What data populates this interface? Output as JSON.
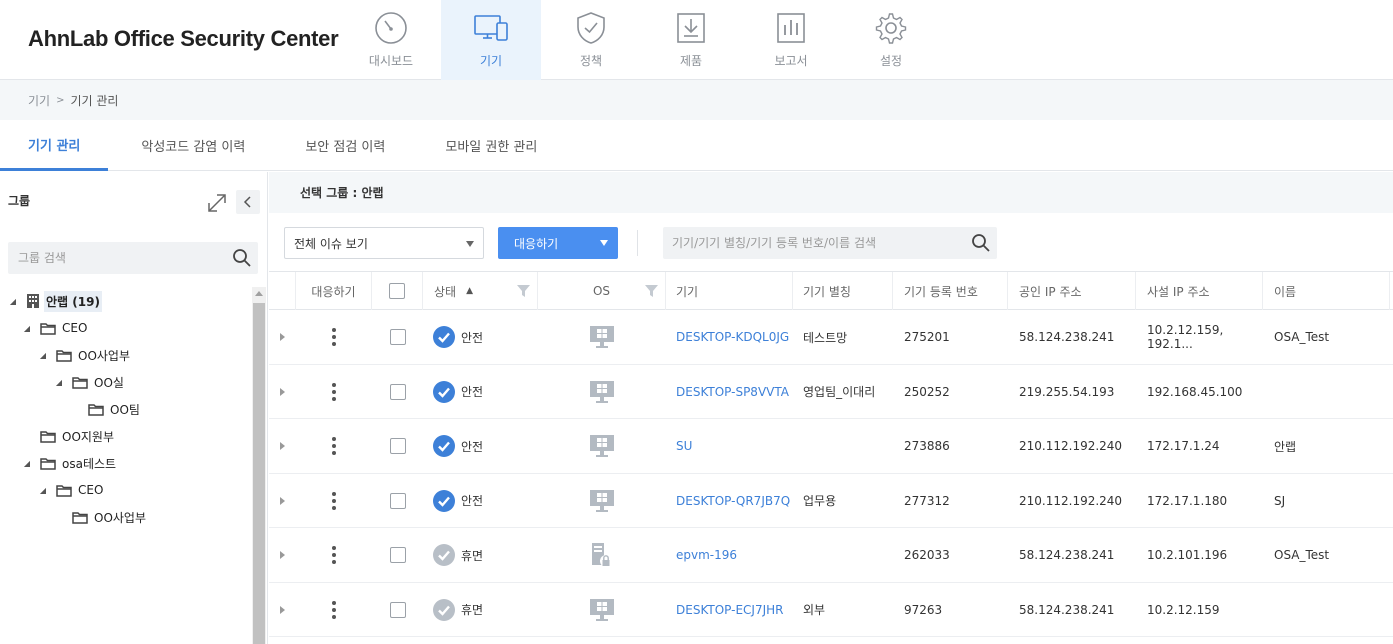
{
  "app": {
    "title": "AhnLab Office Security Center"
  },
  "nav": [
    {
      "label": "대시보드",
      "icon": "dashboard-gauge-icon",
      "active": false
    },
    {
      "label": "기기",
      "icon": "devices-icon",
      "active": true
    },
    {
      "label": "정책",
      "icon": "shield-check-icon",
      "active": false
    },
    {
      "label": "제품",
      "icon": "download-tray-icon",
      "active": false
    },
    {
      "label": "보고서",
      "icon": "report-chart-icon",
      "active": false
    },
    {
      "label": "설정",
      "icon": "gear-icon",
      "active": false
    }
  ],
  "breadcrumb": {
    "root": "기기",
    "sep": ">",
    "current": "기기 관리"
  },
  "tabs": [
    "기기 관리",
    "악성코드 감염 이력",
    "보안 점검 이력",
    "모바일 권한 관리"
  ],
  "sidebar": {
    "title": "그룹",
    "search_placeholder": "그룹 검색",
    "tree": [
      {
        "label": "안랩 (19)",
        "level": 0,
        "type": "building",
        "expanded": true
      },
      {
        "label": "CEO",
        "level": 1,
        "type": "folder",
        "expanded": true
      },
      {
        "label": "OO사업부",
        "level": 2,
        "type": "folder",
        "expanded": true
      },
      {
        "label": "OO실",
        "level": 3,
        "type": "folder",
        "expanded": true
      },
      {
        "label": "OO팀",
        "level": 4,
        "type": "folder",
        "expanded": null
      },
      {
        "label": "OO지원부",
        "level": 1,
        "type": "folder",
        "expanded": null
      },
      {
        "label": "osa테스트",
        "level": 1,
        "type": "folder",
        "expanded": true
      },
      {
        "label": "CEO",
        "level": 2,
        "type": "folder",
        "expanded": true
      },
      {
        "label": "OO사업부",
        "level": 3,
        "type": "folder",
        "expanded": null
      }
    ]
  },
  "main": {
    "selected_group_label": "선택 그룹 : 안랩",
    "filter_value": "전체 이슈 보기",
    "respond_button": "대응하기",
    "search_placeholder": "기기/기기 별칭/기기 등록 번호/이름 검색",
    "columns": [
      "대응하기",
      "",
      "상태",
      "OS",
      "기기",
      "기기 별칭",
      "기기 등록 번호",
      "공인 IP 주소",
      "사설 IP 주소",
      "이름"
    ],
    "sort_indicator": "▲",
    "rows": [
      {
        "status": "안전",
        "status_type": "safe",
        "os": "windows",
        "device": "DESKTOP-KDQL0JG",
        "alias": "테스트망",
        "reg_no": "275201",
        "public_ip": "58.124.238.241",
        "private_ip": "10.2.12.159, 192.1...",
        "name": "OSA_Test"
      },
      {
        "status": "안전",
        "status_type": "safe",
        "os": "windows",
        "device": "DESKTOP-SP8VVTA",
        "alias": "영업팀_이대리",
        "reg_no": "250252",
        "public_ip": "219.255.54.193",
        "private_ip": "192.168.45.100",
        "name": ""
      },
      {
        "status": "안전",
        "status_type": "safe",
        "os": "windows",
        "device": "SU",
        "alias": "",
        "reg_no": "273886",
        "public_ip": "210.112.192.240",
        "private_ip": "172.17.1.24",
        "name": "안랩"
      },
      {
        "status": "안전",
        "status_type": "safe",
        "os": "windows",
        "device": "DESKTOP-QR7JB7Q",
        "alias": "업무용",
        "reg_no": "277312",
        "public_ip": "210.112.192.240",
        "private_ip": "172.17.1.180",
        "name": "SJ"
      },
      {
        "status": "휴면",
        "status_type": "dormant",
        "os": "server",
        "device": "epvm-196",
        "alias": "",
        "reg_no": "262033",
        "public_ip": "58.124.238.241",
        "private_ip": "10.2.101.196",
        "name": "OSA_Test"
      },
      {
        "status": "휴면",
        "status_type": "dormant",
        "os": "windows",
        "device": "DESKTOP-ECJ7JHR",
        "alias": "외부",
        "reg_no": "97263",
        "public_ip": "58.124.238.241",
        "private_ip": "10.2.12.159",
        "name": ""
      }
    ]
  },
  "colors": {
    "accent": "#3d80d8",
    "button": "#4a8ff0",
    "safe": "#3d80d8",
    "dormant": "#b8bfc7"
  }
}
